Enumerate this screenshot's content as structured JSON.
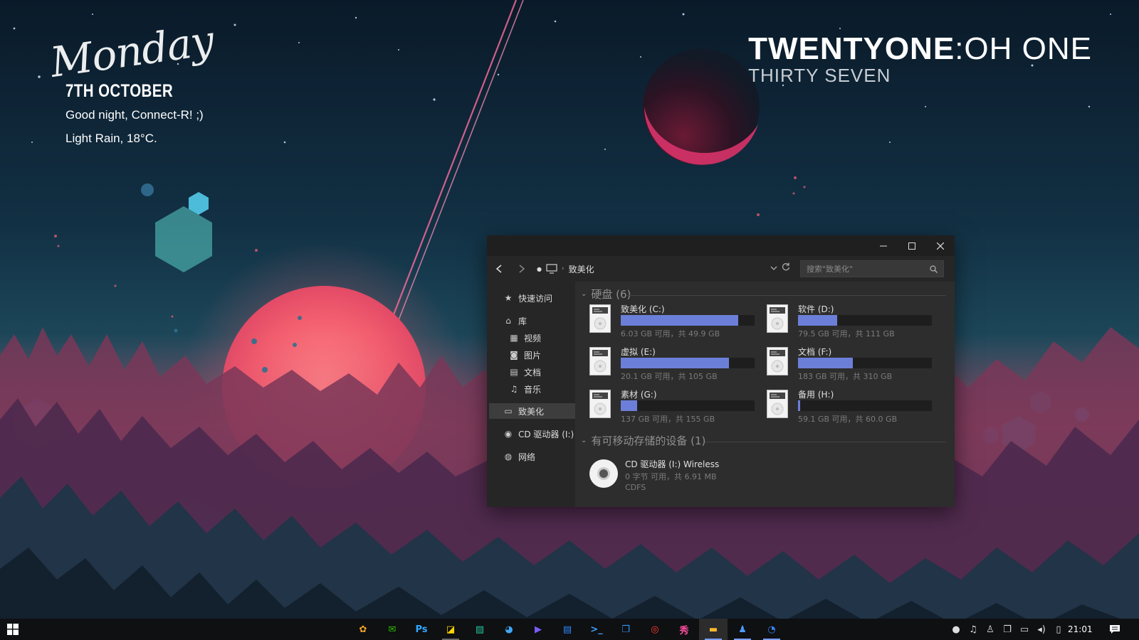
{
  "desktop": {
    "clock": {
      "hours": "TWENTYONE",
      "separator": ":",
      "minutes": "OH ONE",
      "seconds": "THIRTY SEVEN"
    },
    "date_widget": {
      "weekday": "Monday",
      "date": "7TH OCTOBER",
      "greeting": "Good night, Connect-R! ;)",
      "weather": "Light Rain, 18°C."
    }
  },
  "explorer": {
    "window_controls": {
      "minimize": "–",
      "maximize": "☐",
      "close": "✕"
    },
    "address": {
      "location": "致美化",
      "search_placeholder": "搜索\"致美化\""
    },
    "nav_pane": {
      "quick_access": "快速访问",
      "library": "库",
      "videos": "视频",
      "pictures": "图片",
      "documents": "文档",
      "music": "音乐",
      "this_pc": "致美化",
      "cd_drive": "CD 驱动器 (I:)",
      "network": "网络"
    },
    "groups": {
      "hard_disks": "硬盘 (6)",
      "removable": "有可移动存储的设备 (1)"
    },
    "drives": [
      {
        "name": "致美化 (C:)",
        "info": "6.03 GB 可用，共 49.9 GB",
        "used_fraction": 0.88
      },
      {
        "name": "软件 (D:)",
        "info": "79.5 GB 可用，共 111 GB",
        "used_fraction": 0.29
      },
      {
        "name": "虚拟 (E:)",
        "info": "20.1 GB 可用，共 105 GB",
        "used_fraction": 0.81
      },
      {
        "name": "文档 (F:)",
        "info": "183 GB 可用，共 310 GB",
        "used_fraction": 0.41
      },
      {
        "name": "素材 (G:)",
        "info": "137 GB 可用，共 155 GB",
        "used_fraction": 0.12
      },
      {
        "name": "备用 (H:)",
        "info": "59.1 GB 可用，共 60.0 GB",
        "used_fraction": 0.015
      }
    ],
    "cd_drive": {
      "name": "CD 驱动器 (I:) Wireless",
      "info": "0 字节 可用，共 6.91 MB",
      "filesystem": "CDFS"
    }
  },
  "taskbar": {
    "apps": [
      {
        "name": "app-1",
        "icon": "bird",
        "color": "#f5a623"
      },
      {
        "name": "wechat",
        "icon": "chat",
        "color": "#2dc100"
      },
      {
        "name": "photoshop",
        "icon": "Ps",
        "color": "#31a8ff"
      },
      {
        "name": "image-editor",
        "icon": "image",
        "color": "#ffd400"
      },
      {
        "name": "photos",
        "icon": "photo",
        "color": "#25c2a0"
      },
      {
        "name": "paint",
        "icon": "palette",
        "color": "#3fa9f5"
      },
      {
        "name": "media",
        "icon": "play",
        "color": "#7a5cff"
      },
      {
        "name": "notes",
        "icon": "clipboard",
        "color": "#2f88ff"
      },
      {
        "name": "terminal",
        "icon": ">_",
        "color": "#3aa0ff"
      },
      {
        "name": "windows-app",
        "icon": "copy",
        "color": "#2f9bff"
      },
      {
        "name": "netease-music",
        "icon": "music",
        "color": "#ff3b30"
      },
      {
        "name": "font-tool",
        "icon": "秀",
        "color": "#ff4fa0"
      },
      {
        "name": "file-explorer",
        "icon": "folder",
        "color": "#f7b731"
      },
      {
        "name": "qq",
        "icon": "penguin",
        "color": "#4a9cff"
      },
      {
        "name": "browser",
        "icon": "browser",
        "color": "#3b82f6"
      }
    ],
    "tray": {
      "time": "21:01"
    }
  }
}
